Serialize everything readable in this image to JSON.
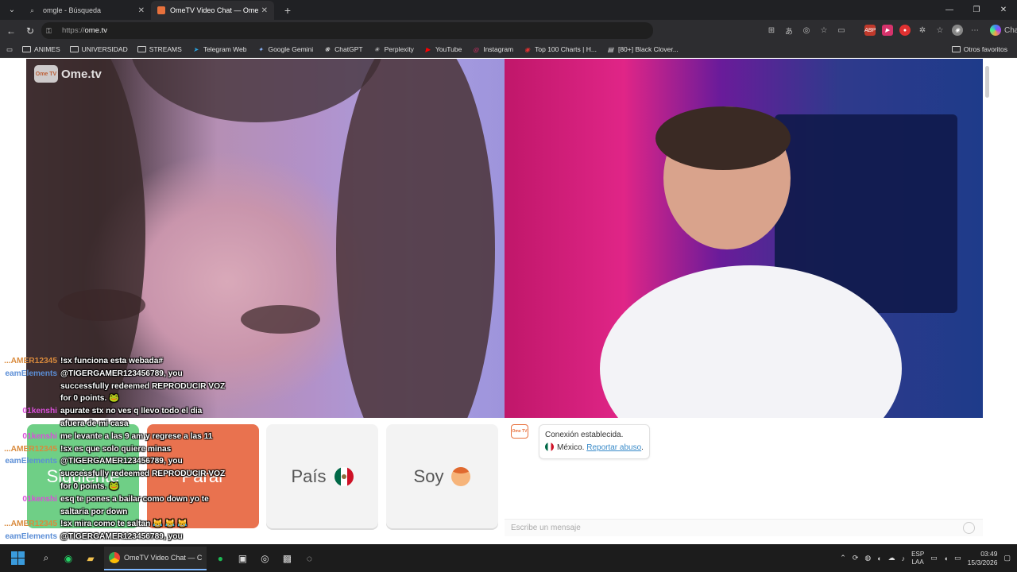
{
  "browser": {
    "tabs": [
      {
        "label": "omgle - Búsqueda",
        "active": false
      },
      {
        "label": "OmeTV Video Chat — Omegle",
        "active": true
      }
    ],
    "url_proto": "https://",
    "url_host": "ome.tv",
    "chat_label": "Chat",
    "bookmarks": [
      "ANIMES",
      "UNIVERSIDAD",
      "STREAMS",
      "Telegram Web",
      "Google Gemini",
      "ChatGPT",
      "Perplexity",
      "YouTube",
      "Instagram",
      "Top 100 Charts | H...",
      "[80+] Black Clover..."
    ],
    "other_bookmarks": "Otros favoritos"
  },
  "site": {
    "logo_text": "Ome.tv",
    "logo_badge": "Ome TV",
    "buttons": {
      "next": "Siguiente",
      "stop": "Parar",
      "country": "País",
      "gender": "Soy"
    },
    "chat": {
      "status": "Conexión establecida.",
      "country": "México.",
      "report_link": "Reportar abuso",
      "input_placeholder": "Escribe un mensaje"
    }
  },
  "overlay_chat": [
    {
      "user": "AMER12345...",
      "user_color": "#d98a3c",
      "text": "!sx funciona esta webada#"
    },
    {
      "user": "eamElements",
      "user_color": "#5b8ed6",
      "text": "@TIGERGAMER123456789, you"
    },
    {
      "user": "",
      "user_color": "#5b8ed6",
      "text": "successfully redeemed REPRODUCIR VOZ"
    },
    {
      "user": "",
      "user_color": "#5b8ed6",
      "text": "for 0 points. 🐸"
    },
    {
      "user": "01kenshi",
      "user_color": "#d94ed9",
      "text": "apurate stx no ves q llevo todo el dia"
    },
    {
      "user": "",
      "user_color": "#d94ed9",
      "text": "afuera de mi casa"
    },
    {
      "user": "01kenshi",
      "user_color": "#d94ed9",
      "text": "me levante a las 9 am y regrese a las 11"
    },
    {
      "user": "AMER12345...",
      "user_color": "#d98a3c",
      "text": "!sx es que solo quiere minas"
    },
    {
      "user": "eamElements",
      "user_color": "#5b8ed6",
      "text": "@TIGERGAMER123456789, you"
    },
    {
      "user": "",
      "user_color": "#5b8ed6",
      "text": "successfully redeemed REPRODUCIR VOZ"
    },
    {
      "user": "",
      "user_color": "#5b8ed6",
      "text": "for 0 points. 🐸"
    },
    {
      "user": "01kenshi",
      "user_color": "#d94ed9",
      "text": "esq te pones a bailar como down yo te"
    },
    {
      "user": "",
      "user_color": "#d94ed9",
      "text": "saltaria por down"
    },
    {
      "user": "AMER12345...",
      "user_color": "#d98a3c",
      "text": "!sx mira como te saltan 😹 😹 😹"
    },
    {
      "user": "eamElements",
      "user_color": "#5b8ed6",
      "text": "@TIGERGAMER123456789, you"
    },
    {
      "user": "",
      "user_color": "#5b8ed6",
      "text": "successfully redeemed REPRODUCIR VOZ"
    },
    {
      "user": "",
      "user_color": "#5b8ed6",
      "text": "for 0 points. 🐸"
    }
  ],
  "taskbar": {
    "app_label": "OmeTV Video Chat — C",
    "lang_1": "ESP",
    "lang_2": "LAA",
    "time": "03:49",
    "date": "15/3/2026"
  },
  "colors": {
    "next_green": "#6fcf86",
    "stop_orange": "#e9724f",
    "link_blue": "#3a8bc9"
  }
}
